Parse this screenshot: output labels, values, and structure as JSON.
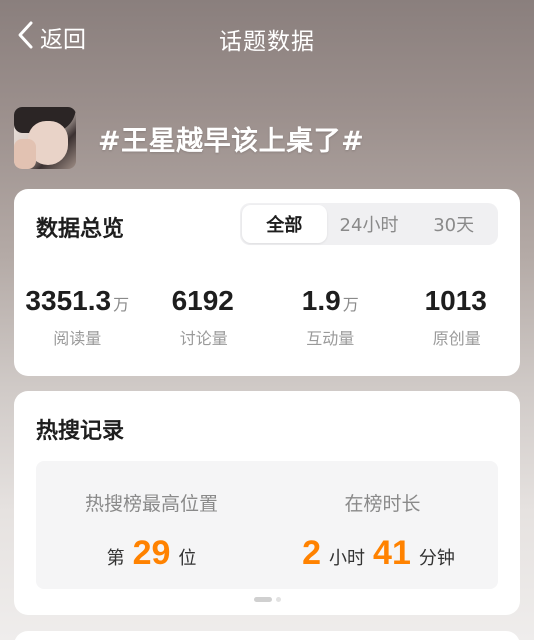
{
  "nav": {
    "back_label": "返回",
    "title": "话题数据"
  },
  "topic": {
    "title": "#王星越早该上桌了#"
  },
  "overview": {
    "title": "数据总览",
    "tabs": [
      "全部",
      "24小时",
      "30天"
    ],
    "active_tab": "全部",
    "stats": [
      {
        "value": "3351.3",
        "unit": "万",
        "label": "阅读量"
      },
      {
        "value": "6192",
        "unit": "",
        "label": "讨论量"
      },
      {
        "value": "1.9",
        "unit": "万",
        "label": "互动量"
      },
      {
        "value": "1013",
        "unit": "",
        "label": "原创量"
      }
    ]
  },
  "hot": {
    "title": "热搜记录",
    "highest": {
      "label": "热搜榜最高位置",
      "prefix": "第",
      "value": "29",
      "suffix": "位"
    },
    "duration": {
      "label": "在榜时长",
      "hours": "2",
      "hours_unit": "小时",
      "minutes": "41",
      "minutes_unit": "分钟"
    },
    "pager": {
      "pages": 2,
      "current": 1
    }
  },
  "colors": {
    "accent": "#ff8200",
    "card": "#ffffff",
    "muted": "#8a8a8a"
  }
}
